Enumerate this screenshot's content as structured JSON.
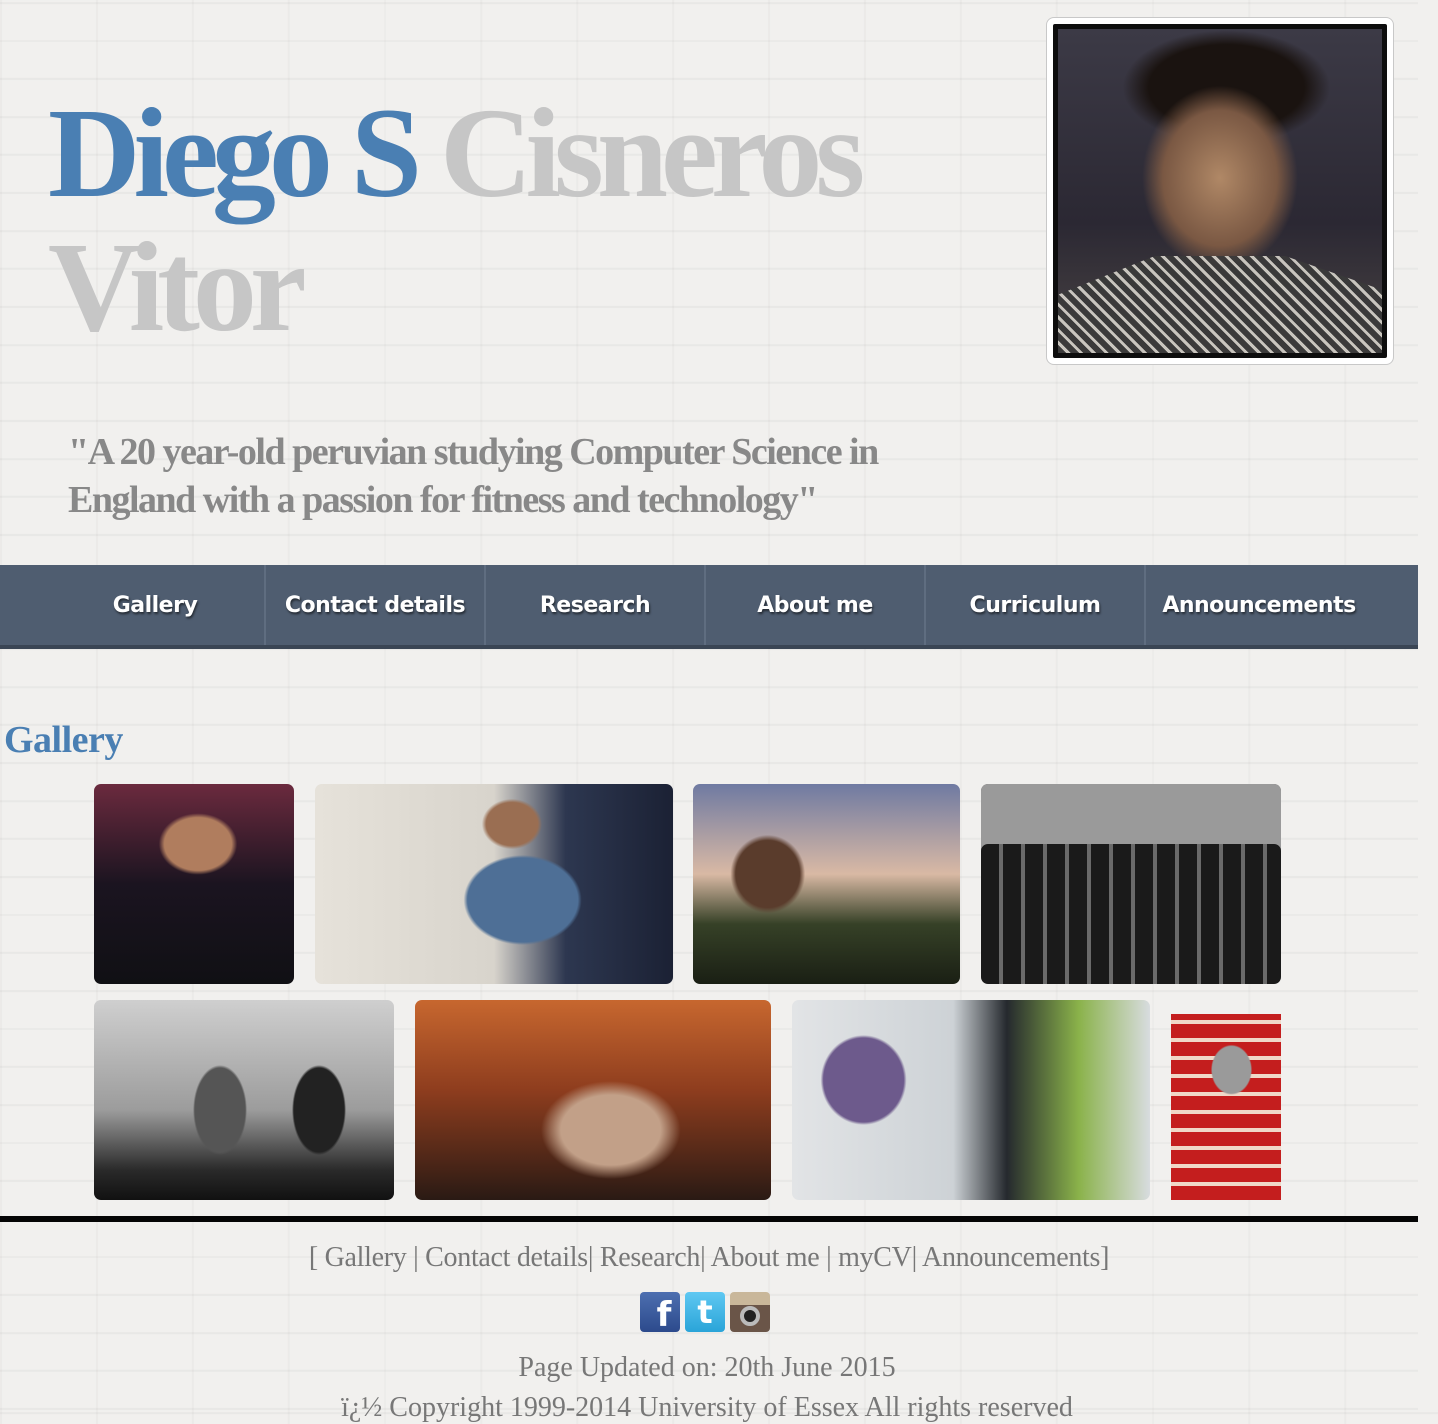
{
  "header": {
    "name_first": "Diego S",
    "name_rest": "Cisneros Vitor",
    "quote": "\"A 20 year-old peruvian studying Computer Science in England with a passion for fitness and technology\""
  },
  "nav": {
    "items": [
      {
        "label": "Gallery"
      },
      {
        "label": "Contact details"
      },
      {
        "label": "Research"
      },
      {
        "label": "About me"
      },
      {
        "label": "Curriculum"
      },
      {
        "label": "Announcements"
      }
    ]
  },
  "gallery": {
    "heading": "Gallery",
    "photo_count": 8
  },
  "footer": {
    "open_bracket": "[",
    "links": [
      "Gallery",
      "Contact details",
      "Research",
      "About me",
      "myCV",
      "Announcements"
    ],
    "close_bracket": "]",
    "social_icons": [
      "facebook-icon",
      "twitter-icon",
      "instagram-icon"
    ],
    "updated": "Page Updated on: 20th June 2015",
    "copyright": "ï¿½ Copyright 1999-2014 University of Essex All rights reserved"
  },
  "colors": {
    "name_blue": "#4a7fb3",
    "name_grey": "#c6c6c6",
    "nav_bg": "#4f5d70",
    "heading_blue": "#4a7fb3"
  }
}
